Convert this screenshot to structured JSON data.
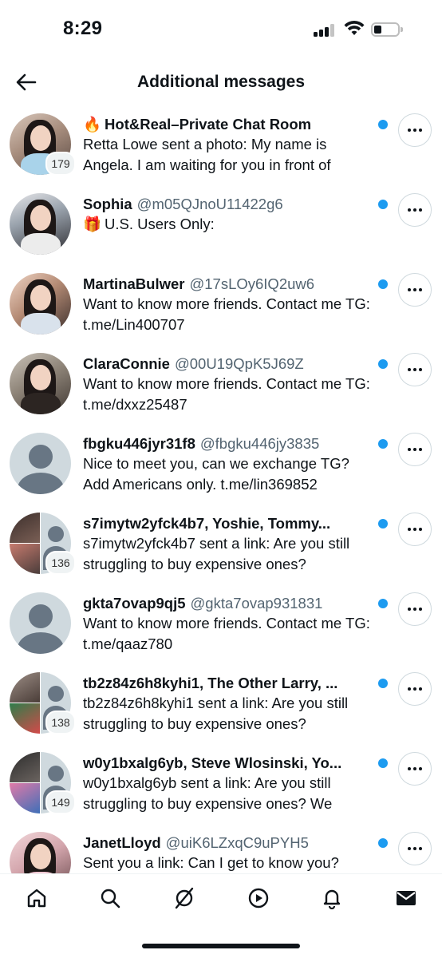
{
  "status_bar": {
    "time": "8:29"
  },
  "header": {
    "title": "Additional messages",
    "back_icon": "arrow-left-icon"
  },
  "conversations": [
    {
      "title": "Hot&Real–Private Chat Room",
      "title_prefix_icon": "fire-emoji",
      "handle": "",
      "message": "Retta Lowe sent a photo: My name is Angela. I am waiting for you in front of",
      "member_count": "179",
      "avatar": "group-photo",
      "unread": true
    },
    {
      "title": "Sophia",
      "handle": "@m05QJnoU11422g6",
      "message": "U.S. Users Only:",
      "message_prefix_icon": "gift-emoji",
      "member_count": "",
      "avatar": "photo",
      "unread": true
    },
    {
      "title": "MartinaBulwer",
      "handle": "@17sLOy6IQ2uw6",
      "message": "Want to know more friends. Contact me TG: t.me/Lin400707",
      "member_count": "",
      "avatar": "photo",
      "unread": true
    },
    {
      "title": "ClaraConnie",
      "handle": "@00U19QpK5J69Z",
      "message": "Want to know more friends. Contact me TG: t.me/dxxz25487",
      "member_count": "",
      "avatar": "photo",
      "unread": true
    },
    {
      "title": "fbgku446jyr31f8",
      "handle": "@fbgku446jy3835",
      "message": "Nice to meet you, can we exchange TG? Add Americans only. t.me/lin369852",
      "member_count": "",
      "avatar": "default",
      "unread": true
    },
    {
      "title": "s7imytw2yfck4b7, Yoshie, Tommy...",
      "handle": "",
      "message": "s7imytw2yfck4b7 sent a link: Are you still struggling to buy expensive ones?",
      "member_count": "136",
      "avatar": "group",
      "unread": true
    },
    {
      "title": "gkta7ovap9qj5",
      "handle": "@gkta7ovap931831",
      "message": "Want to know more friends. Contact me TG: t.me/qaaz780",
      "member_count": "",
      "avatar": "default",
      "unread": true
    },
    {
      "title": "tb2z84z6h8kyhi1, The Other Larry, ...",
      "handle": "",
      "message": "tb2z84z6h8kyhi1 sent a link: Are you still struggling to buy expensive ones?",
      "member_count": "138",
      "avatar": "group",
      "unread": true
    },
    {
      "title": "w0y1bxalg6yb, Steve Wlosinski, Yo...",
      "handle": "",
      "message": "w0y1bxalg6yb sent a link: Are you still struggling to buy expensive ones? We",
      "member_count": "149",
      "avatar": "group",
      "unread": true
    },
    {
      "title": "JanetLloyd",
      "handle": "@uiK6LZxqC9uPYH5",
      "message": "Sent you a link: Can I get to know you?",
      "member_count": "",
      "avatar": "photo",
      "unread": true
    }
  ],
  "tab_bar": [
    "home-icon",
    "search-icon",
    "grok-icon",
    "video-icon",
    "bell-icon",
    "mail-icon"
  ],
  "colors": {
    "accent": "#1d9bf0",
    "text": "#0f1419",
    "secondary": "#536471"
  }
}
